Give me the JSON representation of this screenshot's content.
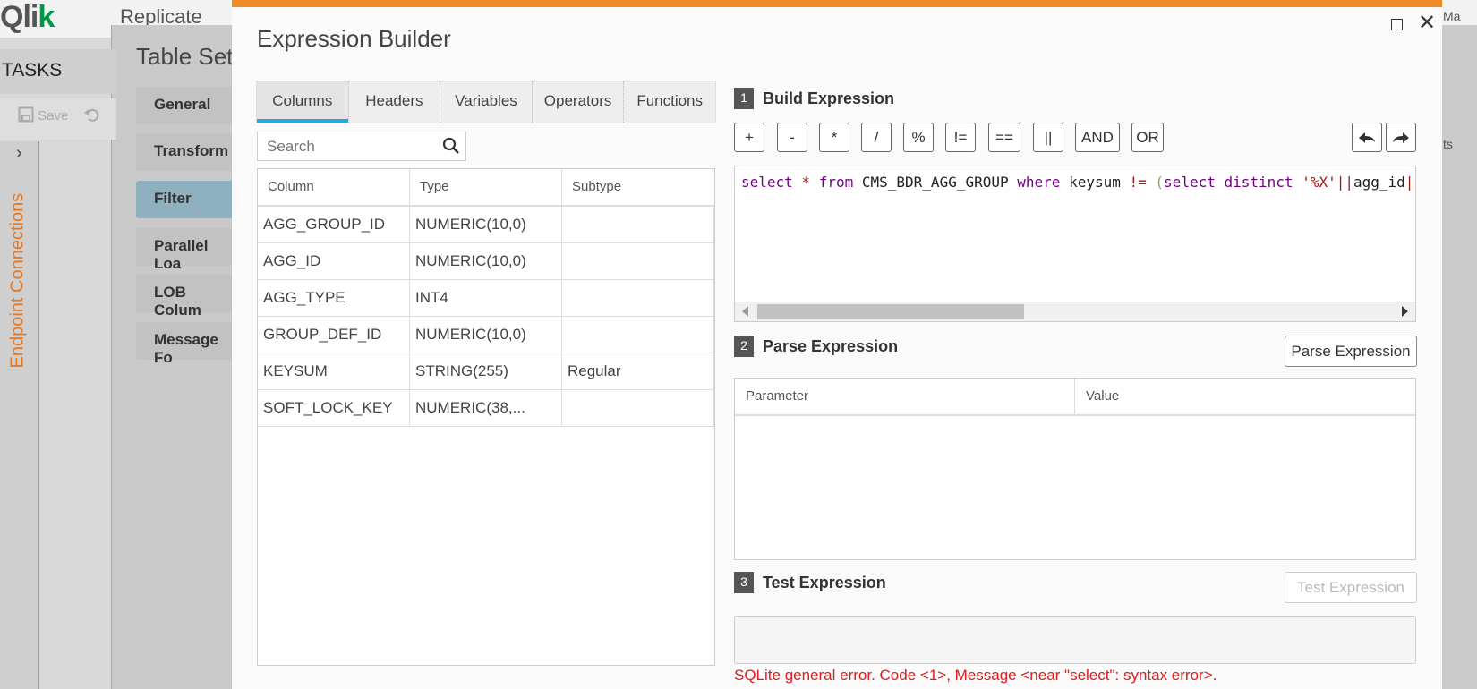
{
  "background_app": {
    "logo": "Qlik",
    "app_title": "Replicate",
    "tasks_label": "TASKS",
    "save_label": "Save",
    "endpoint_connections_label": "Endpoint Connections",
    "panel_title": "Table Set",
    "nav_items": [
      "General",
      "Transform",
      "Filter",
      "Parallel Loa",
      "LOB Colum",
      "Message Fo"
    ],
    "active_nav": "Filter",
    "right_strip_items": [
      "Ma",
      "ts"
    ]
  },
  "dialog": {
    "title": "Expression Builder",
    "accent_color": "#f08a24",
    "tabs": [
      "Columns",
      "Headers",
      "Variables",
      "Operators",
      "Functions"
    ],
    "active_tab": "Columns",
    "search": {
      "placeholder": "Search",
      "value": ""
    },
    "columns_table": {
      "headers": [
        "Column",
        "Type",
        "Subtype"
      ],
      "rows": [
        [
          "AGG_GROUP_ID",
          "NUMERIC(10,0)",
          ""
        ],
        [
          "AGG_ID",
          "NUMERIC(10,0)",
          ""
        ],
        [
          "AGG_TYPE",
          "INT4",
          ""
        ],
        [
          "GROUP_DEF_ID",
          "NUMERIC(10,0)",
          ""
        ],
        [
          "KEYSUM",
          "STRING(255)",
          "Regular"
        ],
        [
          "SOFT_LOCK_KEY",
          "NUMERIC(38,...",
          ""
        ]
      ]
    },
    "build": {
      "step": "1",
      "title": "Build Expression",
      "operators": [
        "+",
        "-",
        "*",
        "/",
        "%",
        "!=",
        "==",
        "||",
        "AND",
        "OR"
      ],
      "expression_tokens": [
        {
          "t": "select",
          "c": "kw"
        },
        {
          "t": " * ",
          "c": "op"
        },
        {
          "t": "from",
          "c": "kw"
        },
        {
          "t": " CMS_BDR_AGG_GROUP ",
          "c": ""
        },
        {
          "t": "where",
          "c": "kw"
        },
        {
          "t": " keysum ",
          "c": ""
        },
        {
          "t": "!=",
          "c": "op"
        },
        {
          "t": " ",
          "c": ""
        },
        {
          "t": "(",
          "c": "paren"
        },
        {
          "t": "select",
          "c": "kw"
        },
        {
          "t": " ",
          "c": ""
        },
        {
          "t": "distinct",
          "c": "kw"
        },
        {
          "t": " ",
          "c": ""
        },
        {
          "t": "'%X'",
          "c": "str"
        },
        {
          "t": "||",
          "c": "op"
        },
        {
          "t": "agg_id",
          "c": ""
        },
        {
          "t": "|",
          "c": "op"
        }
      ]
    },
    "parse": {
      "step": "2",
      "title": "Parse Expression",
      "button_label": "Parse Expression",
      "headers": [
        "Parameter",
        "Value"
      ]
    },
    "test": {
      "step": "3",
      "title": "Test Expression",
      "button_label": "Test Expression",
      "error_message": "SQLite general error. Code <1>, Message <near \"select\": syntax error>."
    }
  }
}
